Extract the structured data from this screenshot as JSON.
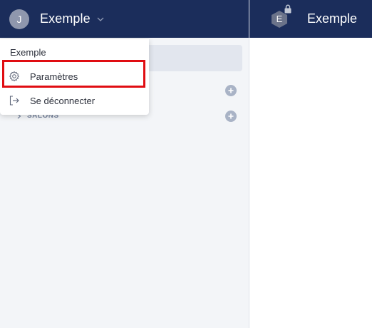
{
  "sidebar": {
    "avatar_initial": "J",
    "workspace_name": "Exemple",
    "section_label": "SALONS"
  },
  "channel": {
    "icon_letter": "E",
    "name": "Exemple"
  },
  "dropdown": {
    "title": "Exemple",
    "items": [
      {
        "label": "Paramètres",
        "icon": "gear-icon"
      },
      {
        "label": "Se déconnecter",
        "icon": "logout-icon"
      }
    ]
  },
  "colors": {
    "header_bg": "#1b2d5b",
    "sidebar_bg": "#f3f5f8",
    "highlight": "#e00d12"
  }
}
